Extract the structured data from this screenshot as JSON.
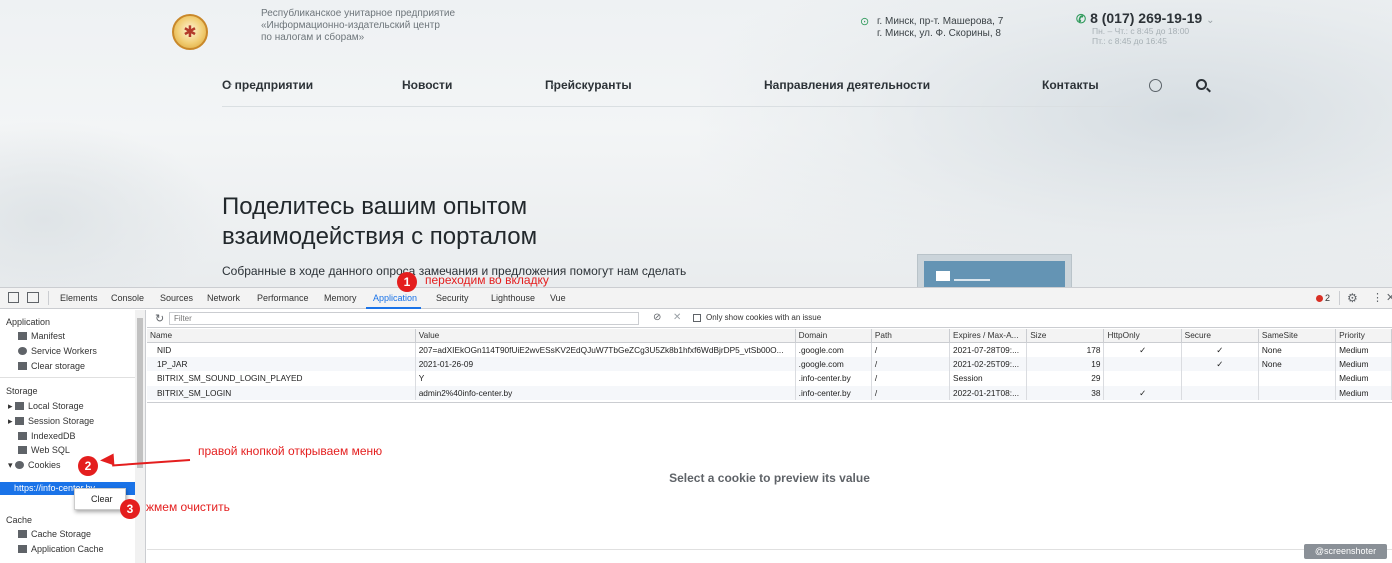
{
  "website": {
    "org_lines": [
      "Республиканское унитарное предприятие",
      "«Информационно-издательский центр",
      "по налогам и сборам»"
    ],
    "address_lines": [
      "г. Минск, пр-т. Машерова, 7",
      "г. Минск, ул. Ф. Скорины, 8"
    ],
    "phone": "8 (017) 269-19-19",
    "hours_lines": [
      "Пн. – Чт.: с 8:45 до 18:00",
      "Пт.: с 8:45 до 16:45"
    ],
    "nav": [
      "О предприятии",
      "Новости",
      "Прейскуранты",
      "Направления деятельности",
      "Контакты"
    ],
    "hero_title_lines": [
      "Поделитесь вашим опытом",
      "взаимодействия с порталом"
    ],
    "hero_subtitle": "Собранные в ходе данного опроса замечания и предложения помогут нам сделать"
  },
  "devtools": {
    "tabs": [
      "Elements",
      "Console",
      "Sources",
      "Network",
      "Performance",
      "Memory",
      "Application",
      "Security",
      "Lighthouse",
      "Vue"
    ],
    "active_tab": "Application",
    "error_count": "2",
    "sidebar": {
      "application_header": "Application",
      "application_items": [
        "Manifest",
        "Service Workers",
        "Clear storage"
      ],
      "storage_header": "Storage",
      "storage_items": [
        "Local Storage",
        "Session Storage",
        "IndexedDB",
        "Web SQL",
        "Cookies"
      ],
      "cookie_origin": "https://info-center.by",
      "cache_header": "Cache",
      "cache_items": [
        "Cache Storage",
        "Application Cache"
      ]
    },
    "context_menu_item": "Clear",
    "filter_placeholder": "Filter",
    "only_issue_label": "Only show cookies with an issue",
    "columns": [
      "Name",
      "Value",
      "Domain",
      "Path",
      "Expires / Max-A...",
      "Size",
      "HttpOnly",
      "Secure",
      "SameSite",
      "Priority"
    ],
    "cookies": [
      {
        "name": "NID",
        "value": "207=adXIEkOGn114T90fUiE2wvESsKV2EdQJuW7TbGeZCg3U5Zk8b1hfxf6WdBjrDP5_vtSb00O...",
        "domain": ".google.com",
        "path": "/",
        "expires": "2021-07-28T09:...",
        "size": "178",
        "httponly": "✓",
        "secure": "✓",
        "samesite": "None",
        "priority": "Medium"
      },
      {
        "name": "1P_JAR",
        "value": "2021-01-26-09",
        "domain": ".google.com",
        "path": "/",
        "expires": "2021-02-25T09:...",
        "size": "19",
        "httponly": "",
        "secure": "✓",
        "samesite": "None",
        "priority": "Medium"
      },
      {
        "name": "BITRIX_SM_SOUND_LOGIN_PLAYED",
        "value": "Y",
        "domain": ".info-center.by",
        "path": "/",
        "expires": "Session",
        "size": "29",
        "httponly": "",
        "secure": "",
        "samesite": "",
        "priority": "Medium"
      },
      {
        "name": "BITRIX_SM_LOGIN",
        "value": "admin2%40info-center.by",
        "domain": ".info-center.by",
        "path": "/",
        "expires": "2022-01-21T08:...",
        "size": "38",
        "httponly": "✓",
        "secure": "",
        "samesite": "",
        "priority": "Medium"
      }
    ],
    "preview_text": "Select a cookie to preview its value"
  },
  "annotations": {
    "step1_num": "1",
    "step1_text": "переходим во вкладку",
    "step2_num": "2",
    "step2_text": "правой кнопкой открываем меню",
    "step3_num": "3",
    "step3_text": "жмем очистить"
  },
  "watermark": "@screenshoter",
  "colors": {
    "accent_blue": "#1a73e8",
    "annotation_red": "#e41e1e",
    "phone_green": "#2f9a5b"
  }
}
